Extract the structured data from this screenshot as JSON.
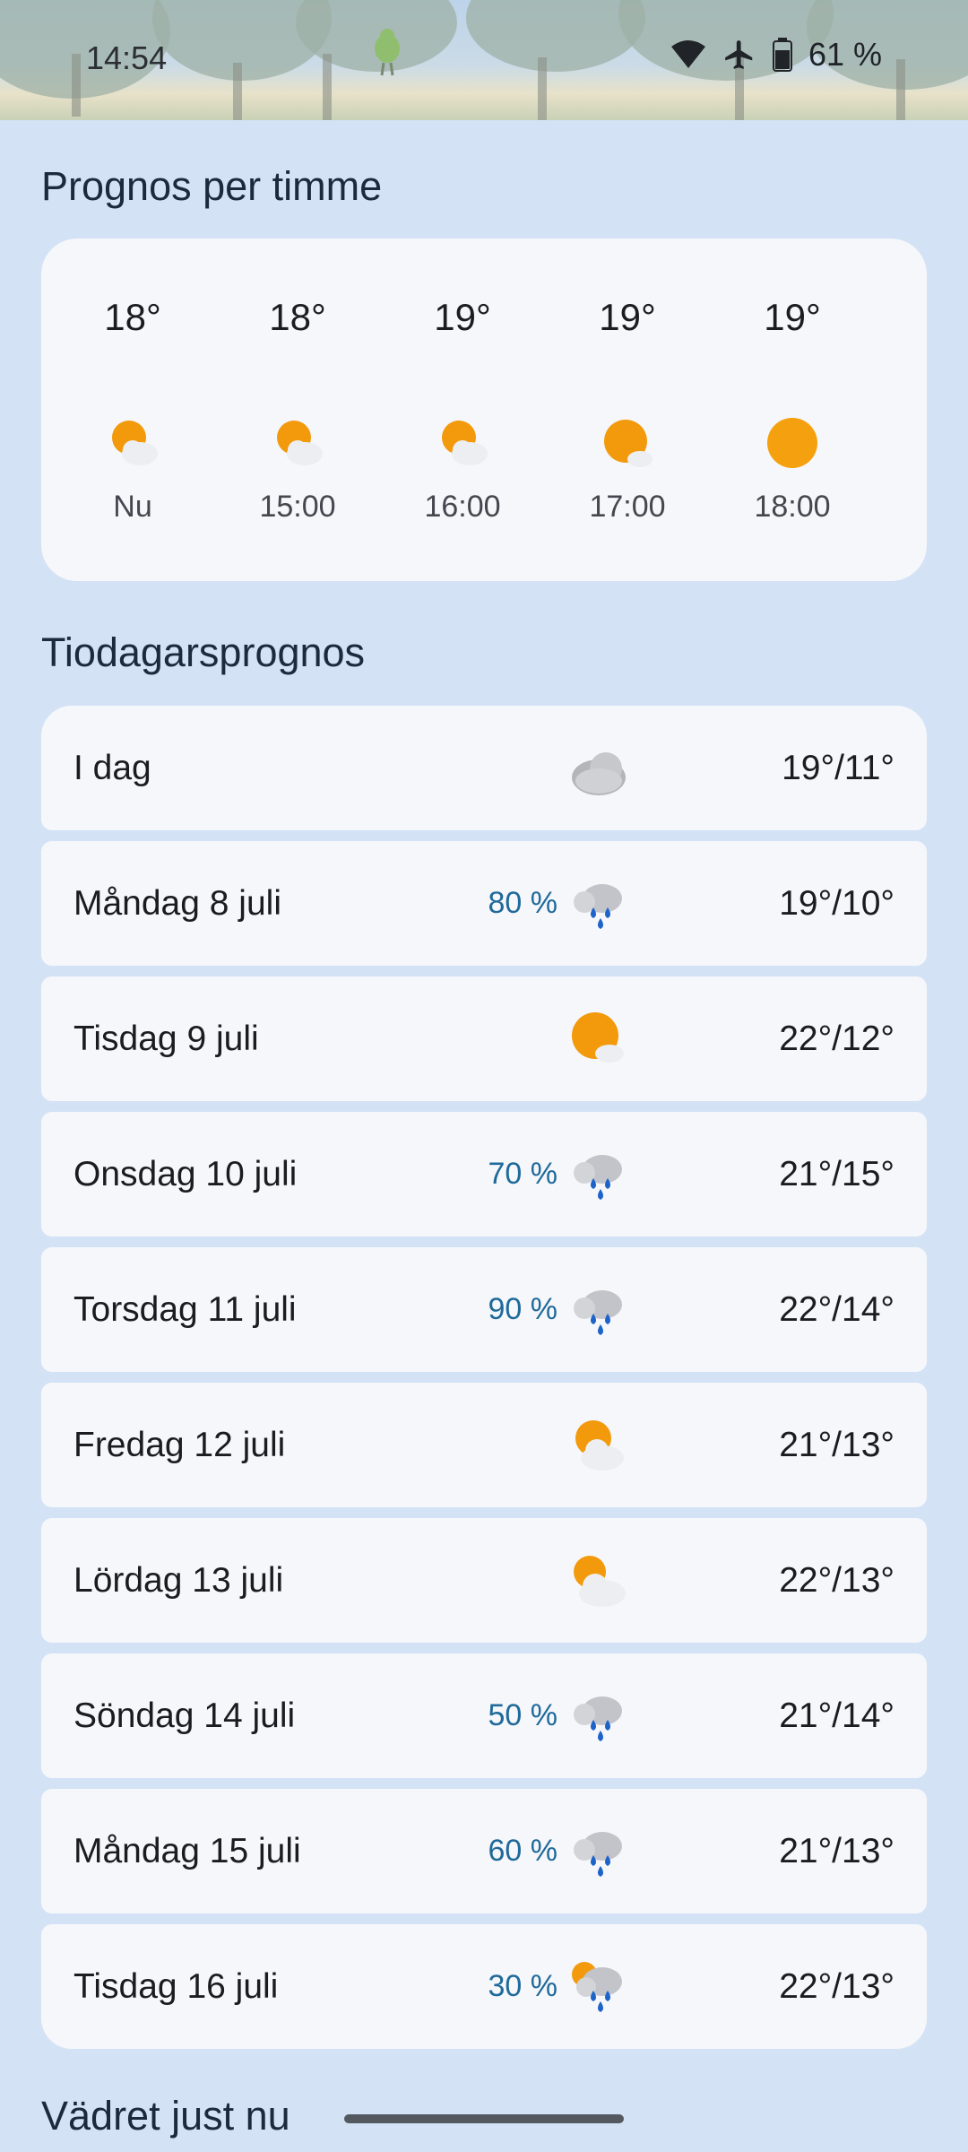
{
  "status_bar": {
    "time": "14:54",
    "battery": "61 %"
  },
  "hourly": {
    "title": "Prognos per timme",
    "items": [
      {
        "temp": "18°",
        "label": "Nu",
        "icon": "partly-cloudy-icon"
      },
      {
        "temp": "18°",
        "label": "15:00",
        "icon": "partly-cloudy-icon"
      },
      {
        "temp": "19°",
        "label": "16:00",
        "icon": "partly-cloudy-icon"
      },
      {
        "temp": "19°",
        "label": "17:00",
        "icon": "mostly-sunny-icon"
      },
      {
        "temp": "19°",
        "label": "18:00",
        "icon": "sunny-icon"
      }
    ]
  },
  "daily": {
    "title": "Tiodagarsprognos",
    "items": [
      {
        "day": "I dag",
        "precip": "",
        "icon": "cloudy-icon",
        "temps": "19°/11°"
      },
      {
        "day": "Måndag 8 juli",
        "precip": "80 %",
        "icon": "rain-icon",
        "temps": "19°/10°"
      },
      {
        "day": "Tisdag 9 juli",
        "precip": "",
        "icon": "mostly-sunny-icon",
        "temps": "22°/12°"
      },
      {
        "day": "Onsdag 10 juli",
        "precip": "70 %",
        "icon": "rain-icon",
        "temps": "21°/15°"
      },
      {
        "day": "Torsdag 11 juli",
        "precip": "90 %",
        "icon": "rain-icon",
        "temps": "22°/14°"
      },
      {
        "day": "Fredag 12 juli",
        "precip": "",
        "icon": "partly-cloudy-icon",
        "temps": "21°/13°"
      },
      {
        "day": "Lördag 13 juli",
        "precip": "",
        "icon": "partly-cloudy-icon",
        "temps": "22°/13°"
      },
      {
        "day": "Söndag 14 juli",
        "precip": "50 %",
        "icon": "rain-icon",
        "temps": "21°/14°"
      },
      {
        "day": "Måndag 15 juli",
        "precip": "60 %",
        "icon": "rain-icon",
        "temps": "21°/13°"
      },
      {
        "day": "Tisdag 16 juli",
        "precip": "30 %",
        "icon": "sun-rain-icon",
        "temps": "22°/13°"
      }
    ]
  },
  "current": {
    "title": "Vädret just nu"
  },
  "colors": {
    "background": "#d3e2f5",
    "card": "#f6f7fb",
    "precip": "#1f6a9a",
    "sun": "#f29a0c",
    "rain": "#1d63c9"
  }
}
